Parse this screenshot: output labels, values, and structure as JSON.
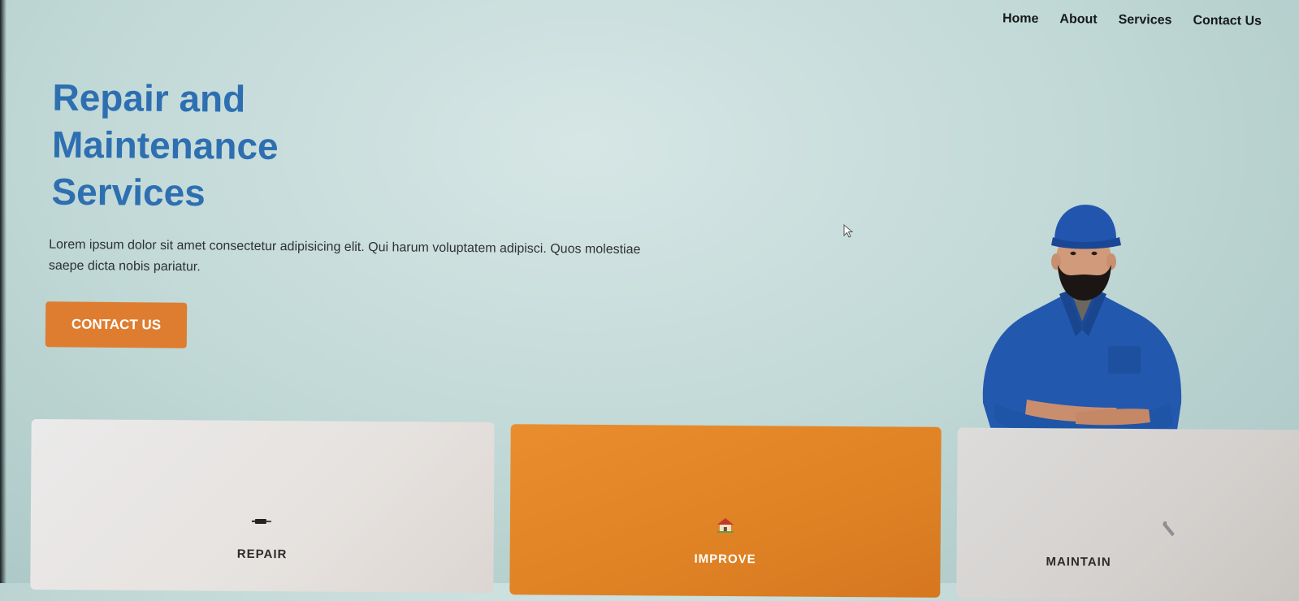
{
  "nav": {
    "items": [
      "Home",
      "About",
      "Services",
      "Contact Us"
    ]
  },
  "hero": {
    "title": "Repair and Maintenance Services",
    "text": "Lorem ipsum dolor sit amet consectetur adipisicing elit. Qui harum voluptatem adipisci. Quos molestiae saepe dicta nobis pariatur.",
    "cta_label": "CONTACT US"
  },
  "cards": [
    {
      "label": "REPAIR",
      "icon": "tool-icon"
    },
    {
      "label": "IMPROVE",
      "icon": "house-icon"
    },
    {
      "label": "MAINTAIN",
      "icon": "wrench-icon"
    }
  ],
  "colors": {
    "title_blue": "#2d6fb1",
    "accent_orange": "#de7d30",
    "card_orange": "#e08726",
    "background": "#c3dad8"
  }
}
